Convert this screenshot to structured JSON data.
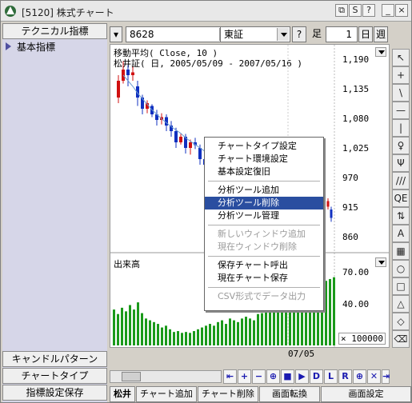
{
  "window": {
    "title": "[5120] 株式チャート"
  },
  "titlebar_buttons": [
    "⧉",
    "S",
    "?",
    "_",
    "□",
    "×"
  ],
  "left": {
    "tab_top": "テクニカル指標",
    "selected_item": "基本指標",
    "tab_candle": "キャンドルパターン",
    "tab_charttype": "チャートタイプ",
    "tab_save": "指標設定保存"
  },
  "toolbar": {
    "code": "8628",
    "market": "東証",
    "help": "?",
    "period_label": "足",
    "period_value": "1",
    "day": "日",
    "week": "週"
  },
  "chart": {
    "title_line1": "移動平均( Close, 10 )",
    "title_line2": "松井証( 日, 2005/05/09 - 2007/05/16 )",
    "y_ticks": [
      "1,190",
      "1,135",
      "1,080",
      "1,025",
      "970",
      "915",
      "860"
    ],
    "volume_label": "出来高",
    "vol_ticks": [
      "70.00",
      "40.00"
    ],
    "vol_multiplier": "× 100000",
    "x_label": "07/05",
    "price_candles": [
      {
        "o": 1120,
        "c": 1150,
        "h": 1160,
        "l": 1110
      },
      {
        "o": 1150,
        "c": 1170,
        "h": 1185,
        "l": 1145
      },
      {
        "o": 1170,
        "c": 1160,
        "h": 1178,
        "l": 1140
      },
      {
        "o": 1160,
        "c": 1165,
        "h": 1175,
        "l": 1150
      },
      {
        "o": 1140,
        "c": 1120,
        "h": 1150,
        "l": 1105
      },
      {
        "o": 1120,
        "c": 1100,
        "h": 1125,
        "l": 1090
      },
      {
        "o": 1100,
        "c": 1110,
        "h": 1115,
        "l": 1092
      },
      {
        "o": 1105,
        "c": 1090,
        "h": 1108,
        "l": 1085
      },
      {
        "o": 1090,
        "c": 1080,
        "h": 1098,
        "l": 1070
      },
      {
        "o": 1080,
        "c": 1085,
        "h": 1092,
        "l": 1072
      },
      {
        "o": 1085,
        "c": 1070,
        "h": 1090,
        "l": 1060
      },
      {
        "o": 1070,
        "c": 1060,
        "h": 1078,
        "l": 1050
      },
      {
        "o": 1060,
        "c": 1040,
        "h": 1066,
        "l": 1030
      },
      {
        "o": 1040,
        "c": 1050,
        "h": 1055,
        "l": 1036
      },
      {
        "o": 1050,
        "c": 1030,
        "h": 1055,
        "l": 1020
      },
      {
        "o": 1030,
        "c": 1040,
        "h": 1045,
        "l": 1018
      },
      {
        "o": 1040,
        "c": 1035,
        "h": 1048,
        "l": 1028
      },
      {
        "o": 1030,
        "c": 1010,
        "h": 1036,
        "l": 1000
      },
      {
        "o": 1010,
        "c": 1000,
        "h": 1015,
        "l": 990
      },
      {
        "o": 1000,
        "c": 1015,
        "h": 1020,
        "l": 995
      },
      {
        "o": 1015,
        "c": 1005,
        "h": 1018,
        "l": 998
      }
    ],
    "late_candles": [
      {
        "o": 925,
        "c": 935,
        "h": 940,
        "l": 920
      },
      {
        "o": 920,
        "c": 905,
        "h": 925,
        "l": 898
      }
    ],
    "ma_points": [
      1160,
      1150,
      1140,
      1128,
      1118,
      1108,
      1098,
      1090,
      1082,
      1075,
      1068,
      1062,
      1056,
      1048,
      1042,
      1036,
      1030,
      1024,
      1018
    ],
    "volume_bars": [
      40,
      35,
      42,
      38,
      45,
      40,
      48,
      36,
      30,
      28,
      26,
      24,
      20,
      22,
      18,
      15,
      16,
      14,
      15,
      14,
      16,
      18,
      20,
      22,
      24,
      22,
      26,
      28,
      24,
      30,
      28,
      26,
      30,
      32,
      30,
      28,
      35,
      36,
      38,
      40,
      42,
      45,
      44,
      50,
      48,
      52,
      58,
      55,
      60,
      62,
      66,
      70,
      68,
      72,
      74,
      76,
      78
    ]
  },
  "context_menu": {
    "items": [
      {
        "label": "チャートタイプ設定",
        "disabled": false
      },
      {
        "label": "チャート環境設定",
        "disabled": false
      },
      {
        "label": "基本設定復旧",
        "disabled": false
      },
      {
        "sep": true
      },
      {
        "label": "分析ツール追加",
        "disabled": false
      },
      {
        "label": "分析ツール削除",
        "disabled": false,
        "highlight": true
      },
      {
        "label": "分析ツール管理",
        "disabled": false
      },
      {
        "sep": true
      },
      {
        "label": "新しいウィンドウ追加",
        "disabled": true
      },
      {
        "label": "現在ウィンドウ削除",
        "disabled": true
      },
      {
        "sep": true
      },
      {
        "label": "保存チャート呼出",
        "disabled": false
      },
      {
        "label": "現在チャート保存",
        "disabled": false
      },
      {
        "sep": true
      },
      {
        "label": "CSV形式でデータ出力",
        "disabled": true
      }
    ]
  },
  "nav_buttons": [
    "⇤",
    "+",
    "−",
    "⊕",
    "■",
    "▶",
    "D",
    "L",
    "R",
    "⊕",
    "✕",
    "⇥"
  ],
  "bottom_tabs": [
    "松井",
    "チャート追加",
    "チャート削除",
    "画面転換",
    "画面設定"
  ],
  "right_tools": [
    "↖",
    "+",
    "\\",
    "—",
    "|",
    "♀",
    "Ψ",
    "///",
    "QE",
    "⇅",
    "A",
    "▦",
    "○",
    "□",
    "△",
    "◇",
    "⌫"
  ]
}
